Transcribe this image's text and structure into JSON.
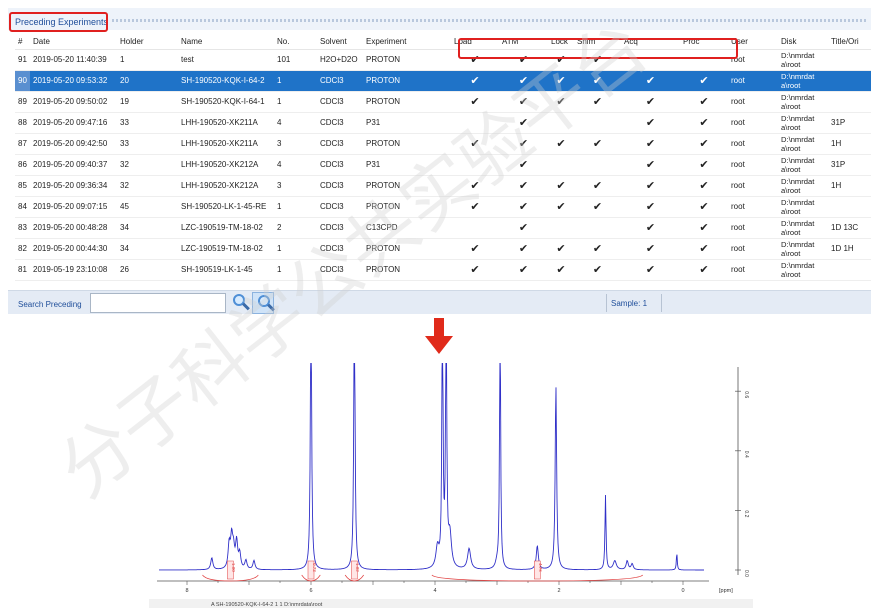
{
  "panel": {
    "title": "Preceding Experiments",
    "columns": [
      "#",
      "Date",
      "Holder",
      "Name",
      "No.",
      "Solvent",
      "Experiment",
      "Load",
      "ATM",
      "Lock",
      "Shim",
      "Acq",
      "Proc",
      "User",
      "Disk",
      "Title/Ori"
    ],
    "check_glyph": "✔",
    "rows": [
      {
        "num": "91",
        "date": "2019-05-20 11:40:39",
        "holder": "1",
        "name": "test",
        "no": "101",
        "solvent": "H2O+D2O",
        "experiment": "PROTON",
        "load": true,
        "atm": true,
        "lock": true,
        "shim": true,
        "acq": false,
        "proc": false,
        "user": "root",
        "disk": "D:\\nmrdat a\\root",
        "title": "",
        "selected": false
      },
      {
        "num": "90",
        "date": "2019-05-20 09:53:32",
        "holder": "20",
        "name": "SH-190520-KQK-I-64-2",
        "no": "1",
        "solvent": "CDCl3",
        "experiment": "PROTON",
        "load": true,
        "atm": true,
        "lock": true,
        "shim": true,
        "acq": true,
        "proc": true,
        "user": "root",
        "disk": "D:\\nmrdat a\\root",
        "title": "",
        "selected": true
      },
      {
        "num": "89",
        "date": "2019-05-20 09:50:02",
        "holder": "19",
        "name": "SH-190520-KQK-I-64-1",
        "no": "1",
        "solvent": "CDCl3",
        "experiment": "PROTON",
        "load": true,
        "atm": true,
        "lock": true,
        "shim": true,
        "acq": true,
        "proc": true,
        "user": "root",
        "disk": "D:\\nmrdat a\\root",
        "title": "",
        "selected": false
      },
      {
        "num": "88",
        "date": "2019-05-20 09:47:16",
        "holder": "33",
        "name": "LHH-190520-XK211A",
        "no": "4",
        "solvent": "CDCl3",
        "experiment": "P31",
        "load": false,
        "atm": true,
        "lock": false,
        "shim": false,
        "acq": true,
        "proc": true,
        "user": "root",
        "disk": "D:\\nmrdat a\\root",
        "title": "31P",
        "selected": false
      },
      {
        "num": "87",
        "date": "2019-05-20 09:42:50",
        "holder": "33",
        "name": "LHH-190520-XK211A",
        "no": "3",
        "solvent": "CDCl3",
        "experiment": "PROTON",
        "load": true,
        "atm": true,
        "lock": true,
        "shim": true,
        "acq": true,
        "proc": true,
        "user": "root",
        "disk": "D:\\nmrdat a\\root",
        "title": "1H",
        "selected": false
      },
      {
        "num": "86",
        "date": "2019-05-20 09:40:37",
        "holder": "32",
        "name": "LHH-190520-XK212A",
        "no": "4",
        "solvent": "CDCl3",
        "experiment": "P31",
        "load": false,
        "atm": true,
        "lock": false,
        "shim": false,
        "acq": true,
        "proc": true,
        "user": "root",
        "disk": "D:\\nmrdat a\\root",
        "title": "31P",
        "selected": false
      },
      {
        "num": "85",
        "date": "2019-05-20 09:36:34",
        "holder": "32",
        "name": "LHH-190520-XK212A",
        "no": "3",
        "solvent": "CDCl3",
        "experiment": "PROTON",
        "load": true,
        "atm": true,
        "lock": true,
        "shim": true,
        "acq": true,
        "proc": true,
        "user": "root",
        "disk": "D:\\nmrdat a\\root",
        "title": "1H",
        "selected": false
      },
      {
        "num": "84",
        "date": "2019-05-20 09:07:15",
        "holder": "45",
        "name": "SH-190520-LK-1-45-RE",
        "no": "1",
        "solvent": "CDCl3",
        "experiment": "PROTON",
        "load": true,
        "atm": true,
        "lock": true,
        "shim": true,
        "acq": true,
        "proc": true,
        "user": "root",
        "disk": "D:\\nmrdat a\\root",
        "title": "",
        "selected": false
      },
      {
        "num": "83",
        "date": "2019-05-20 00:48:28",
        "holder": "34",
        "name": "LZC-190519-TM-18-02",
        "no": "2",
        "solvent": "CDCl3",
        "experiment": "C13CPD",
        "load": false,
        "atm": true,
        "lock": false,
        "shim": false,
        "acq": true,
        "proc": true,
        "user": "root",
        "disk": "D:\\nmrdat a\\root",
        "title": "1D 13C",
        "selected": false
      },
      {
        "num": "82",
        "date": "2019-05-20 00:44:30",
        "holder": "34",
        "name": "LZC-190519-TM-18-02",
        "no": "1",
        "solvent": "CDCl3",
        "experiment": "PROTON",
        "load": true,
        "atm": true,
        "lock": true,
        "shim": true,
        "acq": true,
        "proc": true,
        "user": "root",
        "disk": "D:\\nmrdat a\\root",
        "title": "1D 1H",
        "selected": false
      },
      {
        "num": "81",
        "date": "2019-05-19 23:10:08",
        "holder": "26",
        "name": "SH-190519-LK-1-45",
        "no": "1",
        "solvent": "CDCl3",
        "experiment": "PROTON",
        "load": true,
        "atm": true,
        "lock": true,
        "shim": true,
        "acq": true,
        "proc": true,
        "user": "root",
        "disk": "D:\\nmrdat a\\root",
        "title": "",
        "selected": false
      }
    ]
  },
  "footer": {
    "search_label": "Search Preceding",
    "search_value": "",
    "sample_status": "Sample: 1"
  },
  "spectrum": {
    "x_ticks": [
      "8",
      "6",
      "4",
      "2",
      "0",
      "[ppm]"
    ],
    "y_ticks": [
      "0.6",
      "0.4",
      "0.2",
      "0.0"
    ],
    "integrals": [
      "1.00",
      "0.73",
      "1.02",
      "4.76"
    ],
    "caption": "A  SH-190520-KQK-I-64-2  1  1  D:\\nmrdata\\root",
    "line_color": "#3030c8",
    "integral_color": "#e04040"
  },
  "colors": {
    "selection": "#1f73c8",
    "highlight_box": "#e0201f",
    "arrow": "#e02a1a"
  },
  "watermark": {
    "text": "分子科学公共实验平台"
  }
}
